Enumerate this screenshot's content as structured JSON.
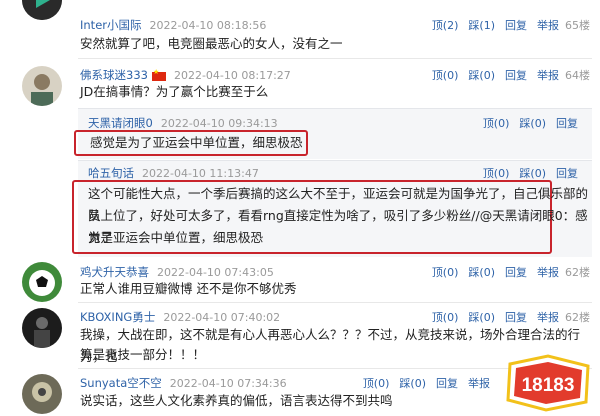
{
  "comments": [
    {
      "user": "Inter小国际",
      "time": "2022-04-10 08:18:56",
      "actions": {
        "up": "顶(2)",
        "down": "踩(1)",
        "reply": "回复",
        "report": "举报",
        "floor": "65楼"
      },
      "text": "安然就算了吧，电竞圈最恶心的女人，没有之一"
    },
    {
      "user": "佛系球迷333",
      "time": "2022-04-10 08:17:27",
      "actions": {
        "up": "顶(0)",
        "down": "踩(0)",
        "reply": "回复",
        "report": "举报",
        "floor": "64楼"
      },
      "text": "JD在搞事情？为了赢个比赛至于么"
    },
    {
      "user": "鸡犬升天恭喜",
      "time": "2022-04-10 07:43:05",
      "actions": {
        "up": "顶(0)",
        "down": "踩(0)",
        "reply": "回复",
        "report": "举报",
        "floor": "62楼"
      },
      "text": "正常人谁用豆瓣微博 还不是你不够优秀"
    },
    {
      "user": "KBOXING勇士",
      "time": "2022-04-10 07:40:02",
      "actions": {
        "up": "顶(0)",
        "down": "踩(0)",
        "reply": "回复",
        "report": "举报",
        "floor": "62楼"
      },
      "text": "我操，大战在即，这不就是有心人再恶心人么？？？不过，从竞技来说，场外合理合法的行为，也",
      "text2": "算是竞技一部分！！！"
    },
    {
      "user": "Sunyata空不空",
      "time": "2022-04-10 07:34:36",
      "actions": {
        "up": "顶(0)",
        "down": "踩(0)",
        "reply": "回复",
        "report": "举报"
      },
      "text": "说实话，这些人文化素养真的偏低，语言表达得不到共鸣"
    }
  ],
  "quotes": [
    {
      "user": "天黑请闭眼0",
      "time": "2022-04-10 09:34:13",
      "actions": {
        "up": "顶(0)",
        "down": "踩(0)",
        "reply": "回复"
      },
      "text": "感觉是为了亚运会中单位置，细思极恐"
    },
    {
      "user": "哈五旬话",
      "time": "2022-04-10 11:13:47",
      "actions": {
        "up": "顶(0)",
        "down": "踩(0)",
        "reply": "回复"
      },
      "lines": [
        "这个可能性大点，一个季后赛搞的这么大不至于，亚运会可就是为国争光了，自己俱乐部的队",
        "员上位了，好处可太多了，看看rng直接定性为啥了，吸引了多少粉丝//@天黑请闭眼0：感觉是",
        "为了亚运会中单位置，细思极恐"
      ]
    }
  ],
  "watermark": "18183"
}
